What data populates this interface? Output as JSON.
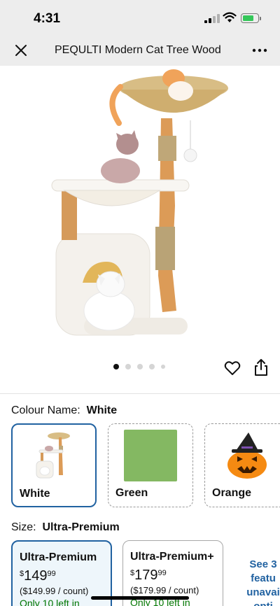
{
  "status_bar": {
    "time": "4:31"
  },
  "header": {
    "title": "PEQULTI Modern Cat Tree Wood"
  },
  "carousel": {
    "total": 5,
    "active": 1
  },
  "colour": {
    "label": "Colour Name:",
    "selected_value": "White",
    "options": [
      {
        "name": "White",
        "selected": true
      },
      {
        "name": "Green",
        "selected": false
      },
      {
        "name": "Orange",
        "selected": false
      }
    ]
  },
  "size": {
    "label": "Size:",
    "selected_value": "Ultra-Premium",
    "options": [
      {
        "name": "Ultra-Premium",
        "currency": "$",
        "price_whole": "149",
        "price_fraction": "99",
        "unit_price": "($149.99 / count)",
        "stock": "Only 10 left in",
        "selected": true
      },
      {
        "name": "Ultra-Premium+",
        "currency": "$",
        "price_whole": "179",
        "price_fraction": "99",
        "unit_price": "($179.99 / count)",
        "stock": "Only 10 left in",
        "selected": false
      }
    ],
    "see_more": "See 3 featu unavai opti"
  },
  "colors": {
    "accent": "#2162a1",
    "in_stock": "#007600"
  }
}
